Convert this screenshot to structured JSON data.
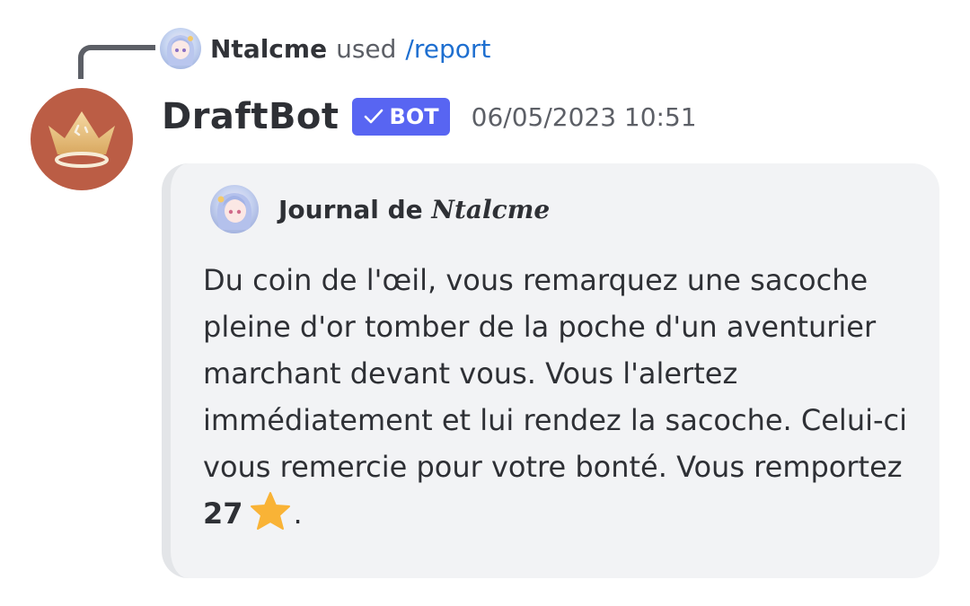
{
  "reply": {
    "user": "Ntalcme",
    "used": "used",
    "command": "/report"
  },
  "message": {
    "author": "DraftBot",
    "bot_tag": "BOT",
    "timestamp": "06/05/2023 10:51"
  },
  "embed": {
    "title_prefix": "Journal de",
    "title_name": "Ntalcme",
    "description": "Du coin de l'œil, vous remarquez une sacoche pleine d'or tomber de la poche d'un aventurier marchant devant vous. Vous l'alertez immédiatement et lui rendez la sacoche. Celui-ci vous remercie pour votre bonté. Vous remportez",
    "reward_value": "27",
    "reward_suffix": ".",
    "reward_icon": "star-icon"
  },
  "colors": {
    "bot_tag": "#5865f2",
    "avatar_bg": "#bb5d45",
    "command": "#1e6fd0",
    "embed_bg": "#f2f3f5",
    "star": "#f9b336"
  }
}
